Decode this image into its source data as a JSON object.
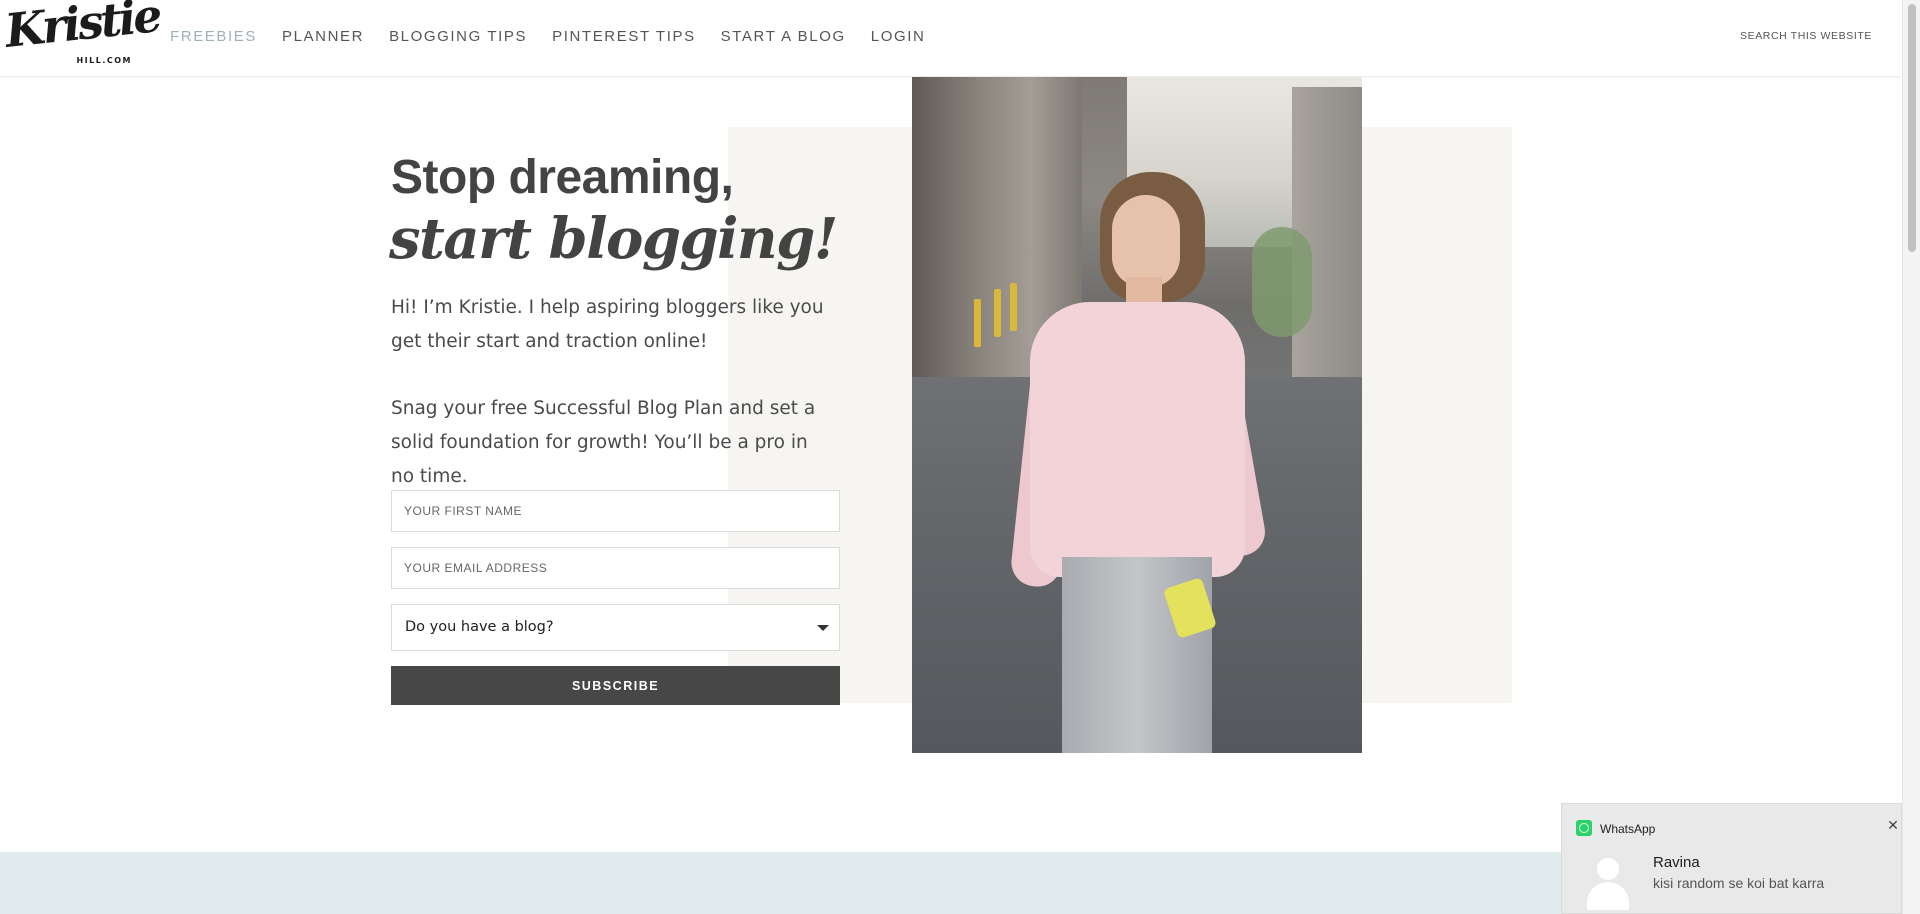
{
  "header": {
    "logo_text": "Kristie",
    "logo_tagline": "HILL.COM",
    "nav": [
      {
        "label": "FREEBIES",
        "active": true
      },
      {
        "label": "PLANNER"
      },
      {
        "label": "BLOGGING TIPS"
      },
      {
        "label": "PINTEREST TIPS"
      },
      {
        "label": "START A BLOG"
      },
      {
        "label": "LOGIN"
      }
    ],
    "search_placeholder": "SEARCH THIS WEBSITE"
  },
  "hero": {
    "title_line1": "Stop dreaming,",
    "title_line2": "start blogging!",
    "intro": "Hi! I’m Kristie. I help aspiring bloggers like you get their start and traction online!",
    "cta_text": "Snag your free Successful Blog Plan and set a solid foundation for growth! You’ll be a pro in no time.",
    "form": {
      "first_name_placeholder": "YOUR FIRST NAME",
      "email_placeholder": "YOUR EMAIL ADDRESS",
      "blog_select_value": "Do you have a blog?",
      "subscribe_label": "SUBSCRIBE"
    }
  },
  "notification": {
    "app_name": "WhatsApp",
    "sender": "Ravina",
    "message": "kisi random se koi bat karra",
    "close_symbol": "✕"
  },
  "colors": {
    "nav_active": "#9fb1b5",
    "text_dark": "#434343",
    "button_bg": "#474747",
    "hero_panel": "#f6f5f2",
    "band": "#dfebec",
    "whatsapp_green": "#25d366"
  }
}
